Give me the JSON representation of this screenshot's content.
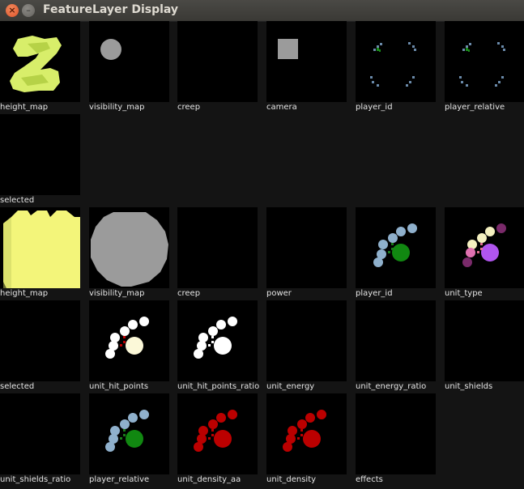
{
  "window": {
    "title": "FeatureLayer Display",
    "buttons": [
      {
        "name": "close",
        "glyph": "×"
      },
      {
        "name": "minimize",
        "glyph": "–"
      }
    ]
  },
  "colors": {
    "neutral_green": "#1a8c1a",
    "player_blue": "#8fb0cc",
    "self_green": "#118811",
    "unit_density_red": "#bb0000",
    "height_yellow": "#d8ee6a",
    "visibility_gray": "#9b9b9b",
    "unit_type_purple": "#b055ee"
  },
  "minimap_layers": [
    {
      "label": "height_map",
      "icon": "height-map-minimap"
    },
    {
      "label": "visibility_map",
      "icon": "visibility-map-minimap"
    },
    {
      "label": "creep",
      "icon": "empty"
    },
    {
      "label": "camera",
      "icon": "camera-square"
    },
    {
      "label": "player_id",
      "icon": "player-id-minimap"
    },
    {
      "label": "player_relative",
      "icon": "player-relative-minimap"
    },
    {
      "label": "selected",
      "icon": "empty"
    }
  ],
  "screen_layers": [
    {
      "label": "height_map",
      "icon": "height-map-screen"
    },
    {
      "label": "visibility_map",
      "icon": "visibility-map-screen"
    },
    {
      "label": "creep",
      "icon": "empty"
    },
    {
      "label": "power",
      "icon": "empty"
    },
    {
      "label": "player_id",
      "icon": "units-player-id"
    },
    {
      "label": "unit_type",
      "icon": "units-unit-type"
    },
    {
      "label": "selected",
      "icon": "empty"
    },
    {
      "label": "unit_hit_points",
      "icon": "units-hit-points"
    },
    {
      "label": "unit_hit_points_ratio",
      "icon": "units-hit-points-ratio"
    },
    {
      "label": "unit_energy",
      "icon": "empty"
    },
    {
      "label": "unit_energy_ratio",
      "icon": "empty"
    },
    {
      "label": "unit_shields",
      "icon": "empty"
    },
    {
      "label": "unit_shields_ratio",
      "icon": "empty"
    },
    {
      "label": "player_relative",
      "icon": "units-player-relative"
    },
    {
      "label": "unit_density_aa",
      "icon": "units-density-aa"
    },
    {
      "label": "unit_density",
      "icon": "units-density"
    },
    {
      "label": "effects",
      "icon": "empty"
    }
  ]
}
